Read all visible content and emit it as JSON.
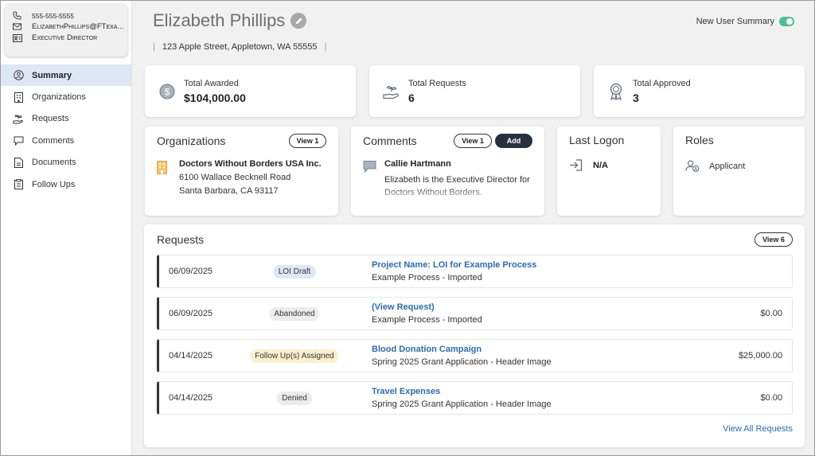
{
  "contact": {
    "phone": "555-555-5555",
    "email": "ElizabethPhillips@FTexa...",
    "title": "Executive Director"
  },
  "nav": {
    "summary": "Summary",
    "organizations": "Organizations",
    "requests": "Requests",
    "comments": "Comments",
    "documents": "Documents",
    "follow_ups": "Follow Ups"
  },
  "header": {
    "name": "Elizabeth Phillips",
    "address": "123 Apple Street, Appletown, WA 55555",
    "separator": "|",
    "toggle_label": "New User Summary",
    "toggle_on": true
  },
  "stats": {
    "awarded_label": "Total Awarded",
    "awarded_value": "$104,000.00",
    "requests_label": "Total Requests",
    "requests_value": "6",
    "approved_label": "Total Approved",
    "approved_value": "3"
  },
  "organizations": {
    "title": "Organizations",
    "view_button": "View 1",
    "name": "Doctors Without Borders USA Inc.",
    "street": "6100 Wallace Becknell Road",
    "city": "Santa Barbara, CA 93117"
  },
  "comments": {
    "title": "Comments",
    "view_button": "View 1",
    "add_button": "Add",
    "author": "Callie Hartmann",
    "text": "Elizabeth is the Executive Director for Doctors Without Borders."
  },
  "last_logon": {
    "title": "Last Logon",
    "value": "N/A"
  },
  "roles": {
    "title": "Roles",
    "value": "Applicant"
  },
  "requests": {
    "title": "Requests",
    "view_button": "View 6",
    "view_all": "View All Requests",
    "rows": [
      {
        "date": "06/09/2025",
        "status": "LOI Draft",
        "title": "Project Name: LOI for Example Process",
        "subtitle": "Example Process - Imported",
        "amount": ""
      },
      {
        "date": "06/09/2025",
        "status": "Abandoned",
        "title": "(View Request)",
        "subtitle": "Example Process - Imported",
        "amount": "$0.00"
      },
      {
        "date": "04/14/2025",
        "status": "Follow Up(s) Assigned",
        "title": "Blood Donation Campaign",
        "subtitle": "Spring 2025 Grant Application - Header Image",
        "amount": "$25,000.00"
      },
      {
        "date": "04/14/2025",
        "status": "Denied",
        "title": "Travel Expenses",
        "subtitle": "Spring 2025 Grant Application - Header Image",
        "amount": "$0.00"
      }
    ]
  },
  "colors": {
    "accent_link": "#2b6cb0",
    "toggle_on": "#4fbf8f",
    "active_nav_bg": "#dde7f6",
    "badge_loi_draft": "#dfe7f5",
    "badge_abandoned": "#ececec",
    "badge_follow_up": "#fbf0cc",
    "badge_denied": "#ececec"
  }
}
